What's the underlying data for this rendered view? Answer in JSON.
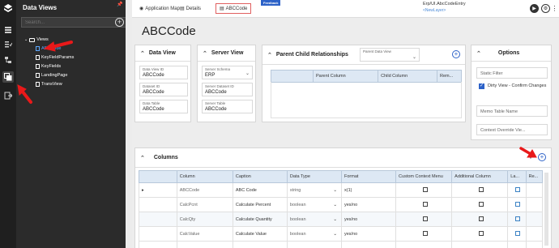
{
  "sidebar": {
    "title": "Data Views",
    "search_placeholder": "Search...",
    "add_icon": "plus-circle-icon",
    "tree": {
      "root": "Views",
      "items": [
        "ABCCode",
        "KeyFieldParams",
        "KeyFields",
        "LandingPage",
        "TransView"
      ],
      "selected": "ABCCode"
    },
    "rail_icons": [
      "logo-icon",
      "layers-icon",
      "checklist-icon",
      "tree-icon",
      "data-views-icon",
      "export-icon"
    ]
  },
  "tabs": [
    {
      "label": "Application Map",
      "icon": "map-pin-icon"
    },
    {
      "label": "Details",
      "icon": "doc-icon"
    },
    {
      "label": "ABCCode",
      "icon": "page-icon",
      "active": true
    }
  ],
  "feedback_label": "Feedback",
  "header": {
    "path": "Erp/UI.AbcCodeEntry",
    "layer": "<NewLayer>"
  },
  "page_title": "ABCCode",
  "data_view": {
    "title": "Data View",
    "fields": [
      {
        "label": "Data View ID",
        "value": "ABCCode"
      },
      {
        "label": "Dataset ID",
        "value": "ABCCode"
      },
      {
        "label": "Data Table",
        "value": "ABCCode"
      }
    ]
  },
  "server_view": {
    "title": "Server View",
    "fields": [
      {
        "label": "Server Schema",
        "value": "ERP"
      },
      {
        "label": "Server Dataset ID",
        "value": "ABCCode"
      },
      {
        "label": "Server Table",
        "value": "ABCCode"
      }
    ]
  },
  "parent_child": {
    "title": "Parent Child Relationships",
    "select_label": "Parent Data View",
    "columns": [
      "Parent Column",
      "Child Column",
      "Rem..."
    ]
  },
  "options": {
    "title": "Options",
    "static_filter": "Static Filter",
    "dirty_view": "Dirty View - Confirm Changes",
    "dirty_checked": true,
    "memo_table": "Memo Table Name",
    "context_override": "Context Override Vie..."
  },
  "columns_section": {
    "title": "Columns",
    "headers": [
      "Column",
      "Caption",
      "Data Type",
      "Format",
      "Custom Context Menu",
      "Additional Column",
      "La...",
      "Re..."
    ],
    "rows": [
      {
        "column": "ABCCode",
        "caption": "ABC Code",
        "type": "string",
        "format": "x(1)"
      },
      {
        "column": "CalcPcnt",
        "caption": "Calculate Percent",
        "type": "boolean",
        "format": "yes/no"
      },
      {
        "column": "CalcQty",
        "caption": "Calculate Quantity",
        "type": "boolean",
        "format": "yes/no"
      },
      {
        "column": "CalcValue",
        "caption": "Calculate Value",
        "type": "boolean",
        "format": "yes/no"
      },
      {
        "column": "",
        "caption": "",
        "type": "",
        "format": ""
      }
    ]
  },
  "colors": {
    "rail": "#1f1f1f",
    "panel": "#2b2b2b",
    "accent": "#2d62c8",
    "annotation": "#e8191a",
    "header_row": "#dde8f4"
  }
}
